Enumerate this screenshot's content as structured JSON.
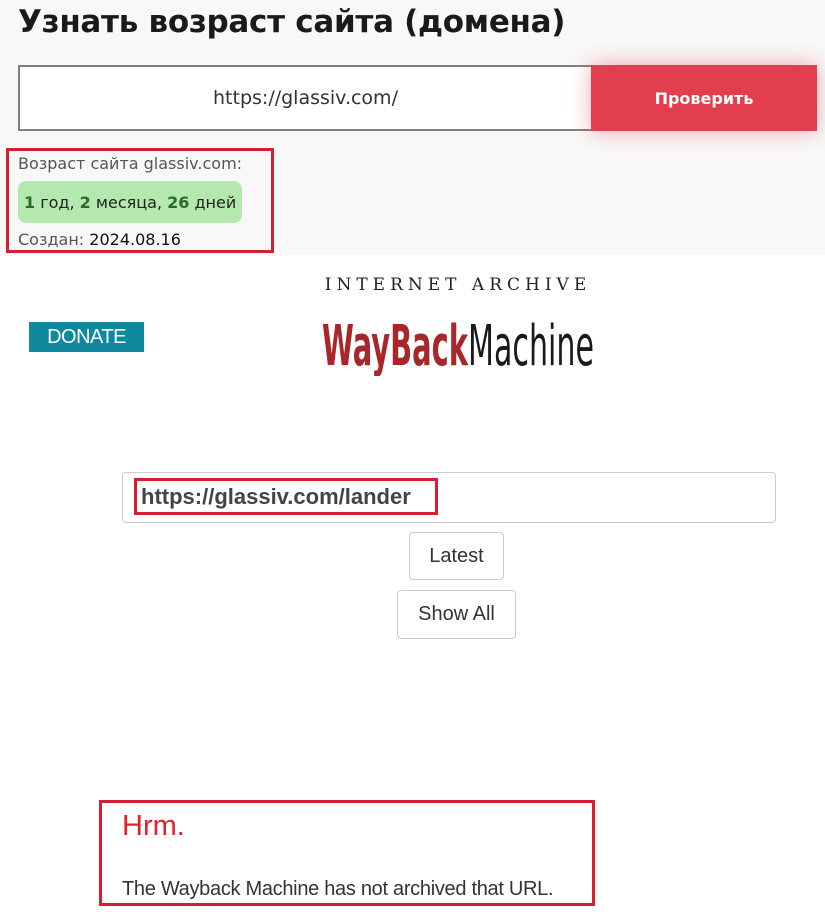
{
  "age_checker": {
    "title": "Узнать возраст сайта (домена)",
    "input_value": "https://glassiv.com/",
    "check_button_label": "Проверить",
    "result": {
      "label": "Возраст сайта glassiv.com:",
      "years_num": "1",
      "years_word": "год,",
      "months_num": "2",
      "months_word": "месяца,",
      "days_num": "26",
      "days_word": "дней",
      "created_label": "Создан:",
      "created_date": "2024.08.16"
    }
  },
  "wayback": {
    "donate_label": "DONATE",
    "logo_top_text": "INTERNET ARCHIVE",
    "logo_wayback": "WayBack",
    "logo_machine": "Machine",
    "search_value": "https://glassiv.com/lander",
    "latest_label": "Latest",
    "show_all_label": "Show All",
    "error_title": "Hrm.",
    "error_message": "The Wayback Machine has not archived that URL."
  },
  "colors": {
    "accent_red": "#e23e4e",
    "highlight_red": "#d32030",
    "badge_green": "#b4e8ae",
    "donate_teal": "#10899e",
    "wayback_red": "#a8272b"
  },
  "icons": [
    "internet-archive-logo"
  ]
}
